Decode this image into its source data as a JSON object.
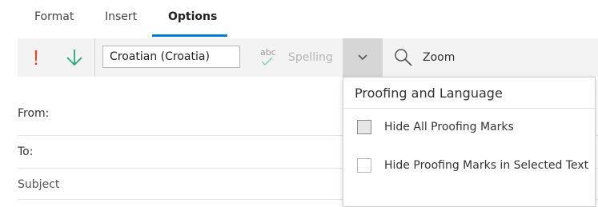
{
  "tabs": [
    {
      "label": "Format"
    },
    {
      "label": "Insert"
    },
    {
      "label": "Options"
    }
  ],
  "active_tab": "Options",
  "toolbar": {
    "importance_icon": "exclamation-icon",
    "low_importance_icon": "arrow-down-icon",
    "language_value": "Croatian (Croatia)",
    "spelling_icon_text": "abc",
    "spelling_label": "Spelling",
    "dropdown_icon": "chevron-down-icon",
    "zoom_label": "Zoom"
  },
  "fields": {
    "from_label": "From:",
    "to_label": "To:",
    "subject_label": "Subject"
  },
  "popup": {
    "title": "Proofing and Language",
    "items": [
      {
        "label": "Hide All Proofing Marks",
        "checked": false
      },
      {
        "label": "Hide Proofing Marks in Selected Text",
        "checked": false
      }
    ]
  },
  "colors": {
    "accent": "#0078d4",
    "importance": "#e0442a",
    "low_importance": "#2ca57c"
  }
}
